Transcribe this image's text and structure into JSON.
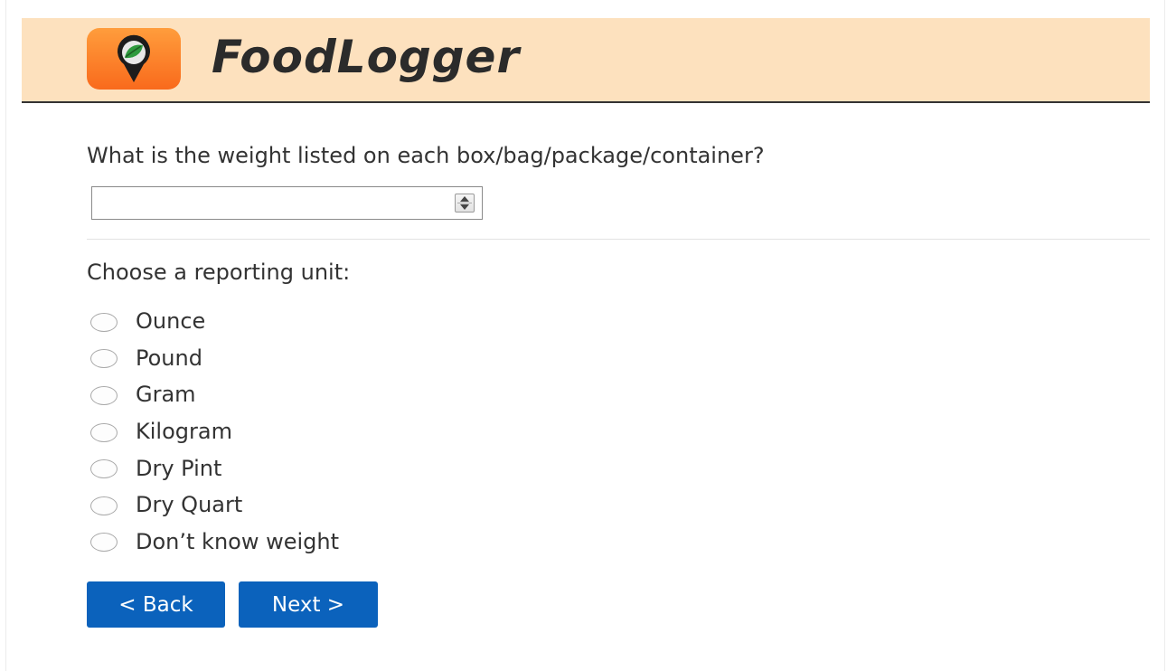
{
  "header": {
    "brand": "FoodLogger",
    "logo_icon": "map-pin-leaf-icon",
    "bg_color": "#fde1be"
  },
  "question": {
    "text": "What is the weight listed on each box/bag/package/container?",
    "input_value": "",
    "input_placeholder": ""
  },
  "units": {
    "prompt": "Choose a reporting unit:",
    "options": [
      {
        "label": "Ounce",
        "selected": false
      },
      {
        "label": "Pound",
        "selected": false
      },
      {
        "label": "Gram",
        "selected": false
      },
      {
        "label": "Kilogram",
        "selected": false
      },
      {
        "label": "Dry Pint",
        "selected": false
      },
      {
        "label": "Dry Quart",
        "selected": false
      },
      {
        "label": "Don’t know weight",
        "selected": false
      }
    ]
  },
  "nav": {
    "back_label": "< Back",
    "next_label": "Next >",
    "button_color": "#0b62bc"
  }
}
